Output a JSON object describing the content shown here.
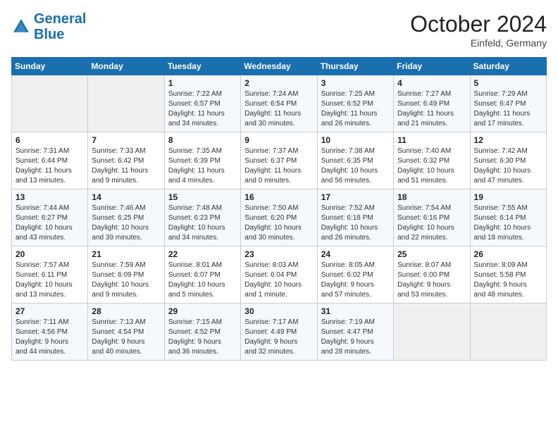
{
  "header": {
    "logo_line1": "General",
    "logo_line2": "Blue",
    "month": "October 2024",
    "location": "Einfeld, Germany"
  },
  "weekdays": [
    "Sunday",
    "Monday",
    "Tuesday",
    "Wednesday",
    "Thursday",
    "Friday",
    "Saturday"
  ],
  "rows": [
    [
      {
        "day": "",
        "content": ""
      },
      {
        "day": "",
        "content": ""
      },
      {
        "day": "1",
        "content": "Sunrise: 7:22 AM\nSunset: 6:57 PM\nDaylight: 11 hours\nand 34 minutes."
      },
      {
        "day": "2",
        "content": "Sunrise: 7:24 AM\nSunset: 6:54 PM\nDaylight: 11 hours\nand 30 minutes."
      },
      {
        "day": "3",
        "content": "Sunrise: 7:25 AM\nSunset: 6:52 PM\nDaylight: 11 hours\nand 26 minutes."
      },
      {
        "day": "4",
        "content": "Sunrise: 7:27 AM\nSunset: 6:49 PM\nDaylight: 11 hours\nand 21 minutes."
      },
      {
        "day": "5",
        "content": "Sunrise: 7:29 AM\nSunset: 6:47 PM\nDaylight: 11 hours\nand 17 minutes."
      }
    ],
    [
      {
        "day": "6",
        "content": "Sunrise: 7:31 AM\nSunset: 6:44 PM\nDaylight: 11 hours\nand 13 minutes."
      },
      {
        "day": "7",
        "content": "Sunrise: 7:33 AM\nSunset: 6:42 PM\nDaylight: 11 hours\nand 9 minutes."
      },
      {
        "day": "8",
        "content": "Sunrise: 7:35 AM\nSunset: 6:39 PM\nDaylight: 11 hours\nand 4 minutes."
      },
      {
        "day": "9",
        "content": "Sunrise: 7:37 AM\nSunset: 6:37 PM\nDaylight: 11 hours\nand 0 minutes."
      },
      {
        "day": "10",
        "content": "Sunrise: 7:38 AM\nSunset: 6:35 PM\nDaylight: 10 hours\nand 56 minutes."
      },
      {
        "day": "11",
        "content": "Sunrise: 7:40 AM\nSunset: 6:32 PM\nDaylight: 10 hours\nand 51 minutes."
      },
      {
        "day": "12",
        "content": "Sunrise: 7:42 AM\nSunset: 6:30 PM\nDaylight: 10 hours\nand 47 minutes."
      }
    ],
    [
      {
        "day": "13",
        "content": "Sunrise: 7:44 AM\nSunset: 6:27 PM\nDaylight: 10 hours\nand 43 minutes."
      },
      {
        "day": "14",
        "content": "Sunrise: 7:46 AM\nSunset: 6:25 PM\nDaylight: 10 hours\nand 39 minutes."
      },
      {
        "day": "15",
        "content": "Sunrise: 7:48 AM\nSunset: 6:23 PM\nDaylight: 10 hours\nand 34 minutes."
      },
      {
        "day": "16",
        "content": "Sunrise: 7:50 AM\nSunset: 6:20 PM\nDaylight: 10 hours\nand 30 minutes."
      },
      {
        "day": "17",
        "content": "Sunrise: 7:52 AM\nSunset: 6:18 PM\nDaylight: 10 hours\nand 26 minutes."
      },
      {
        "day": "18",
        "content": "Sunrise: 7:54 AM\nSunset: 6:16 PM\nDaylight: 10 hours\nand 22 minutes."
      },
      {
        "day": "19",
        "content": "Sunrise: 7:55 AM\nSunset: 6:14 PM\nDaylight: 10 hours\nand 18 minutes."
      }
    ],
    [
      {
        "day": "20",
        "content": "Sunrise: 7:57 AM\nSunset: 6:11 PM\nDaylight: 10 hours\nand 13 minutes."
      },
      {
        "day": "21",
        "content": "Sunrise: 7:59 AM\nSunset: 6:09 PM\nDaylight: 10 hours\nand 9 minutes."
      },
      {
        "day": "22",
        "content": "Sunrise: 8:01 AM\nSunset: 6:07 PM\nDaylight: 10 hours\nand 5 minutes."
      },
      {
        "day": "23",
        "content": "Sunrise: 8:03 AM\nSunset: 6:04 PM\nDaylight: 10 hours\nand 1 minute."
      },
      {
        "day": "24",
        "content": "Sunrise: 8:05 AM\nSunset: 6:02 PM\nDaylight: 9 hours\nand 57 minutes."
      },
      {
        "day": "25",
        "content": "Sunrise: 8:07 AM\nSunset: 6:00 PM\nDaylight: 9 hours\nand 53 minutes."
      },
      {
        "day": "26",
        "content": "Sunrise: 8:09 AM\nSunset: 5:58 PM\nDaylight: 9 hours\nand 48 minutes."
      }
    ],
    [
      {
        "day": "27",
        "content": "Sunrise: 7:11 AM\nSunset: 4:56 PM\nDaylight: 9 hours\nand 44 minutes."
      },
      {
        "day": "28",
        "content": "Sunrise: 7:13 AM\nSunset: 4:54 PM\nDaylight: 9 hours\nand 40 minutes."
      },
      {
        "day": "29",
        "content": "Sunrise: 7:15 AM\nSunset: 4:52 PM\nDaylight: 9 hours\nand 36 minutes."
      },
      {
        "day": "30",
        "content": "Sunrise: 7:17 AM\nSunset: 4:49 PM\nDaylight: 9 hours\nand 32 minutes."
      },
      {
        "day": "31",
        "content": "Sunrise: 7:19 AM\nSunset: 4:47 PM\nDaylight: 9 hours\nand 28 minutes."
      },
      {
        "day": "",
        "content": ""
      },
      {
        "day": "",
        "content": ""
      }
    ]
  ]
}
